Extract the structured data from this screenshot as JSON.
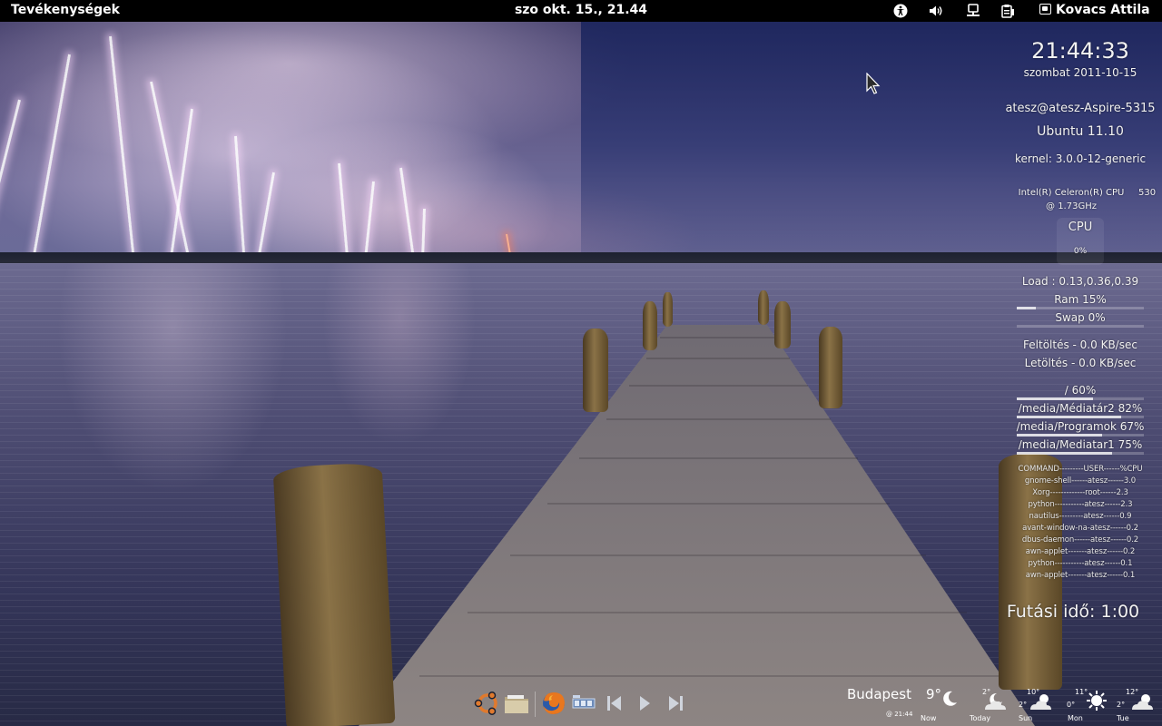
{
  "top_panel": {
    "activities_label": "Tevékenységek",
    "clock": "szo okt. 15., 21.44",
    "user_name": "Kovacs Attila",
    "tray_icons": [
      "accessibility-icon",
      "volume-icon",
      "network-icon",
      "clipboard-icon"
    ]
  },
  "conky": {
    "time": "21:44:33",
    "date": "szombat 2011-10-15",
    "user_host": "atesz@atesz-Aspire-5315",
    "os": "Ubuntu 11.10",
    "kernel": "kernel: 3.0.0-12-generic",
    "cpu_model_line1": "Intel(R) Celeron(R) CPU",
    "cpu_model_num": "530",
    "cpu_model_line2": "@ 1.73GHz",
    "cpu_label": "CPU",
    "cpu_percent": "0%",
    "load": "Load : 0.13,0.36,0.39",
    "ram": "Ram 15%",
    "ram_fraction": 0.15,
    "swap": "Swap 0%",
    "swap_fraction": 0.0,
    "upload": "Feltöltés - 0.0 KB/sec",
    "download": "Letöltés - 0.0 KB/sec",
    "filesystems": [
      {
        "label": "/ 60%",
        "fraction": 0.6
      },
      {
        "label": "/media/Médiatár2 82%",
        "fraction": 0.82
      },
      {
        "label": "/media/Programok 67%",
        "fraction": 0.67
      },
      {
        "label": "/media/Mediatar1 75%",
        "fraction": 0.75
      }
    ],
    "processes": [
      "COMMAND---------USER------%CPU",
      "gnome-shell------atesz------3.0",
      "Xorg-------------root------2.3",
      "python-----------atesz------2.3",
      "nautilus---------atesz------0.9",
      "avant-window-na-atesz------0.2",
      "dbus-daemon------atesz------0.2",
      "awn-applet-------atesz------0.2",
      "python-----------atesz------0.1",
      "awn-applet-------atesz------0.1"
    ],
    "uptime": "Futási idő: 1:00"
  },
  "dock": {
    "icons": [
      "ubuntu-logo-icon",
      "file-manager-icon",
      "firefox-icon",
      "workspace-switcher-icon",
      "previous-track-icon",
      "play-icon",
      "next-track-icon"
    ]
  },
  "weather": {
    "city": "Budapest",
    "current_temp": "9°",
    "updated": "@ 21:44",
    "now_label": "Now",
    "days": [
      {
        "label": "Today",
        "high": "2°",
        "low": ""
      },
      {
        "label": "Sun",
        "high": "10°",
        "low": "2°"
      },
      {
        "label": "Mon",
        "high": "11°",
        "low": "0°"
      },
      {
        "label": "Tue",
        "high": "12°",
        "low": "2°"
      }
    ]
  }
}
